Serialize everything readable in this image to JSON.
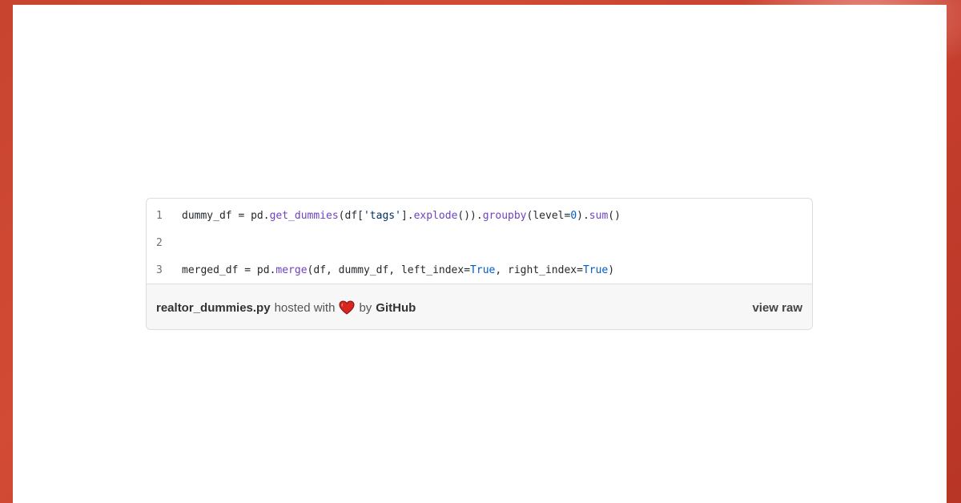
{
  "gist": {
    "lines": [
      {
        "number": "1",
        "code_tokens": [
          {
            "t": "dummy_df = pd.",
            "c": ""
          },
          {
            "t": "get_dummies",
            "c": "fn"
          },
          {
            "t": "(df[",
            "c": ""
          },
          {
            "t": "'tags'",
            "c": "str"
          },
          {
            "t": "].",
            "c": ""
          },
          {
            "t": "explode",
            "c": "fn"
          },
          {
            "t": "()).",
            "c": ""
          },
          {
            "t": "groupby",
            "c": "fn"
          },
          {
            "t": "(level=",
            "c": ""
          },
          {
            "t": "0",
            "c": "num"
          },
          {
            "t": ").",
            "c": ""
          },
          {
            "t": "sum",
            "c": "fn"
          },
          {
            "t": "()",
            "c": ""
          }
        ]
      },
      {
        "number": "2",
        "code_tokens": []
      },
      {
        "number": "3",
        "code_tokens": [
          {
            "t": "merged_df = pd.",
            "c": ""
          },
          {
            "t": "merge",
            "c": "fn"
          },
          {
            "t": "(df, dummy_df, left_index=",
            "c": ""
          },
          {
            "t": "True",
            "c": "kw"
          },
          {
            "t": ", right_index=",
            "c": ""
          },
          {
            "t": "True",
            "c": "kw"
          },
          {
            "t": ")",
            "c": ""
          }
        ]
      }
    ],
    "meta": {
      "filename": "realtor_dummies.py",
      "hosted_with": "hosted with",
      "heart_icon": "heart-icon",
      "by": "by",
      "github": "GitHub",
      "view_raw": "view raw"
    }
  },
  "colors": {
    "background": "#c8442f",
    "function": "#6f42c1",
    "string": "#032f62",
    "constant": "#005cc5",
    "heart": "#d7261e"
  }
}
